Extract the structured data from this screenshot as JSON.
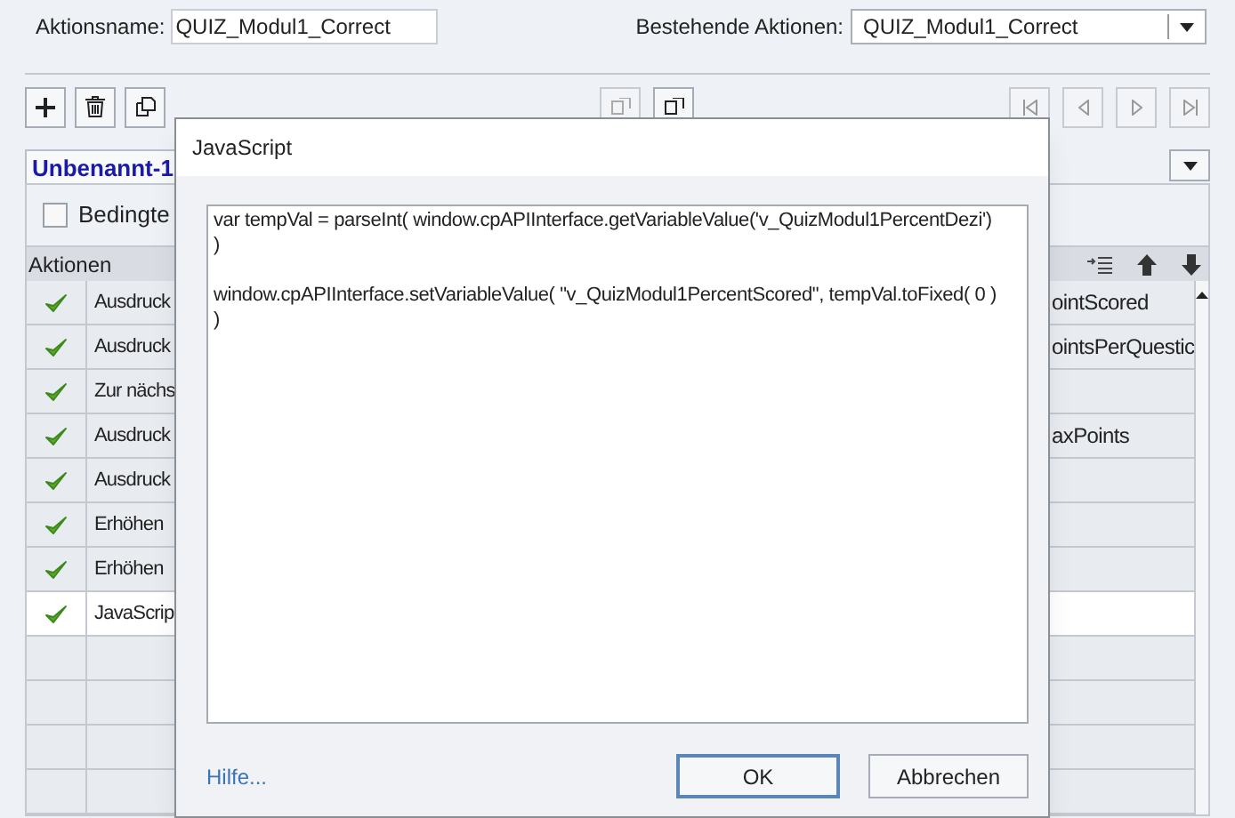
{
  "action_name": {
    "label": "Aktionsname:",
    "value": "QUIZ_Modul1_Correct"
  },
  "existing_actions": {
    "label": "Bestehende Aktionen:",
    "value": "QUIZ_Modul1_Correct"
  },
  "tab": {
    "label": "Unbenannt-1",
    "selected": true
  },
  "condition": {
    "label": "Bedingte",
    "checked": false
  },
  "table": {
    "header": "Aktionen",
    "rows": [
      {
        "enabled": true,
        "action": "Ausdruck",
        "detail": "ointScored",
        "selected": false
      },
      {
        "enabled": true,
        "action": "Ausdruck",
        "detail": "ointsPerQuestic",
        "selected": false
      },
      {
        "enabled": true,
        "action": "Zur nächs",
        "selected": false
      },
      {
        "enabled": true,
        "action": "Ausdruck",
        "detail": "axPoints",
        "selected": false
      },
      {
        "enabled": true,
        "action": "Ausdruck",
        "selected": false
      },
      {
        "enabled": true,
        "action": "Erhöhen",
        "selected": false
      },
      {
        "enabled": true,
        "action": "Erhöhen",
        "selected": false
      },
      {
        "enabled": true,
        "action": "JavaScrip",
        "selected": true
      },
      {
        "enabled": false,
        "selected": false
      },
      {
        "enabled": false,
        "selected": false
      },
      {
        "enabled": false,
        "selected": false
      },
      {
        "enabled": false,
        "selected": false
      }
    ]
  },
  "dialog": {
    "title": "JavaScript",
    "code": "var tempVal = parseInt( window.cpAPIInterface.getVariableValue('v_QuizModul1PercentDezi')\n)\n\nwindow.cpAPIInterface.setVariableValue( \"v_QuizModul1PercentScored\", tempVal.toFixed( 0 )\n)",
    "help_link": "Hilfe...",
    "buttons": [
      {
        "label": "OK",
        "default": true
      },
      {
        "label": "Abbrechen",
        "default": false
      }
    ]
  }
}
